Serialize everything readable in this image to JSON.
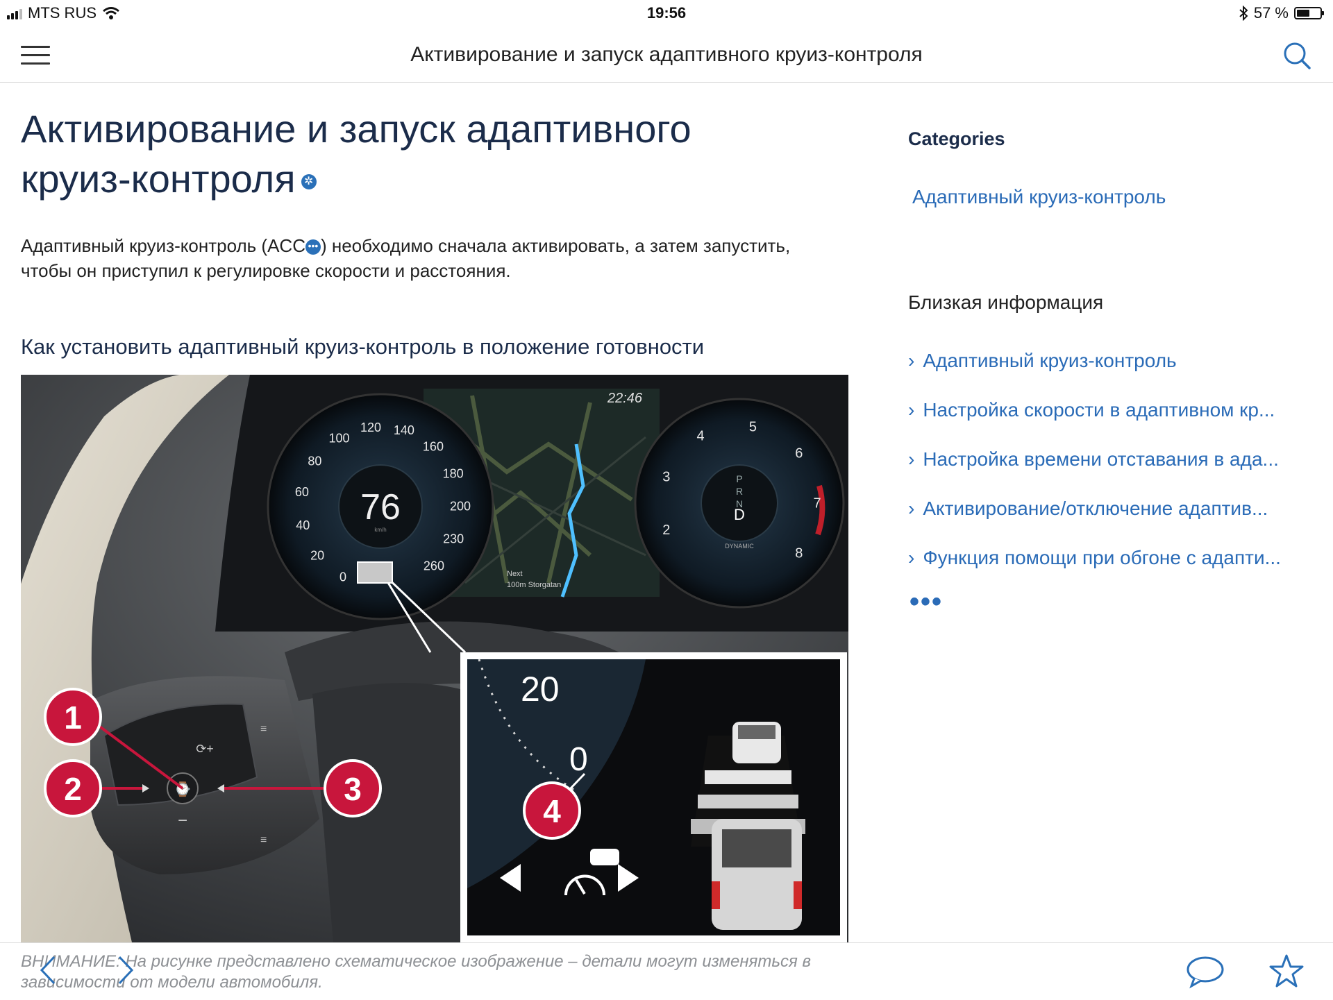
{
  "status_bar": {
    "carrier": "MTS RUS",
    "time": "19:56",
    "battery": "57 %",
    "battery_level": 0.57
  },
  "nav": {
    "title": "Активирование и запуск адаптивного круиз-контроля"
  },
  "article": {
    "title": "Активирование и запуск адаптивного круиз-контроля",
    "intro_part1": "Адаптивный круиз-контроль (ACC",
    "intro_part2": ") необходимо сначала активировать, а затем запустить, чтобы он приступил к регулировке скорости и расстояния.",
    "section_heading": "Как установить адаптивный круиз-контроль в положение готовности",
    "caption": "ВНИМАНИЕ: На рисунке представлено схематическое изображение – детали могут изменяться в зависимости от модели автомобиля."
  },
  "figure": {
    "clock": "22:46",
    "speed": "76",
    "speed_unit": "km/h",
    "speedo_ticks": [
      "0",
      "20",
      "40",
      "60",
      "80",
      "100",
      "120",
      "140",
      "160",
      "180",
      "200",
      "230",
      "260"
    ],
    "tacho_ticks": [
      "2",
      "3",
      "4",
      "5",
      "6",
      "7",
      "8"
    ],
    "gears": [
      "P",
      "R",
      "N",
      "D"
    ],
    "drive_mode": "DYNAMIC",
    "nav_next": "Next",
    "nav_street": "100m Storgatan",
    "inset_20": "20",
    "inset_0": "0",
    "callouts": [
      "1",
      "2",
      "3",
      "4"
    ]
  },
  "sidebar": {
    "categories_heading": "Categories",
    "category_link": "Адаптивный круиз-контроль",
    "related_heading": "Близкая информация",
    "related_items": [
      "Адаптивный круиз-контроль",
      "Настройка скорости в адаптивном кр...",
      "Настройка времени отставания в ада...",
      "Активирование/отключение адаптив...",
      "Функция помощи при обгоне с адапти..."
    ],
    "more": "•••"
  },
  "colors": {
    "title": "#1b2c4a",
    "link": "#2a6bb7",
    "callout": "#c8163c",
    "accent": "#2a70b8"
  },
  "icons": [
    "menu-icon",
    "search-icon",
    "wifi-icon",
    "bluetooth-icon",
    "battery-icon",
    "back-arrow-icon",
    "forward-arrow-icon",
    "comment-icon",
    "star-icon"
  ]
}
